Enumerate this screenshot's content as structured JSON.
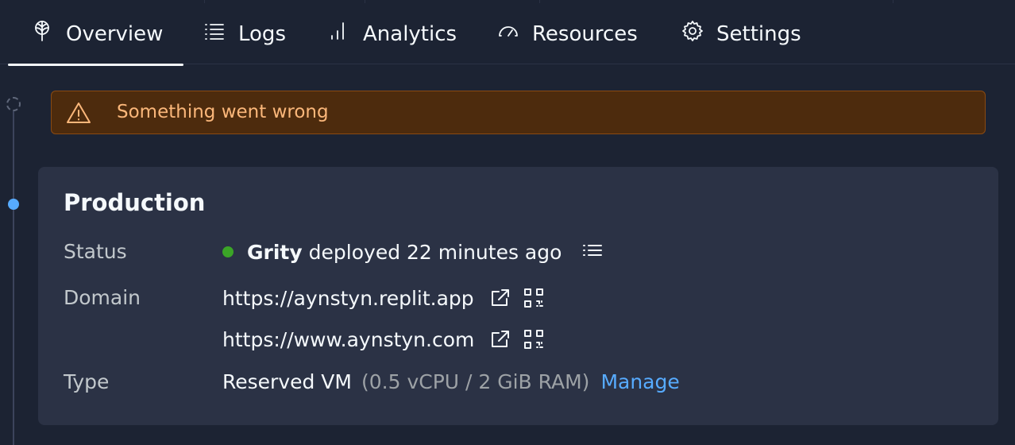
{
  "tabs": [
    {
      "label": "Overview",
      "icon": "deployment-tree-icon",
      "active": true
    },
    {
      "label": "Logs",
      "icon": "list-icon"
    },
    {
      "label": "Analytics",
      "icon": "bar-chart-icon"
    },
    {
      "label": "Resources",
      "icon": "gauge-icon"
    },
    {
      "label": "Settings",
      "icon": "gear-icon"
    }
  ],
  "alert": {
    "message": "Something went wrong",
    "icon": "warning-triangle-icon",
    "color": "#fbb77a"
  },
  "production": {
    "title": "Production",
    "status": {
      "label": "Status",
      "user": "Grity",
      "text": "deployed 22 minutes ago",
      "dot_color": "#3ba527"
    },
    "domain": {
      "label": "Domain",
      "urls": [
        "https://aynstyn.replit.app",
        "https://www.aynstyn.com"
      ]
    },
    "type": {
      "label": "Type",
      "value": "Reserved VM",
      "spec": "(0.5 vCPU / 2 GiB RAM)",
      "manage_label": "Manage"
    }
  },
  "colors": {
    "accent": "#57abff",
    "background": "#1c2333",
    "card": "#2b3245"
  }
}
